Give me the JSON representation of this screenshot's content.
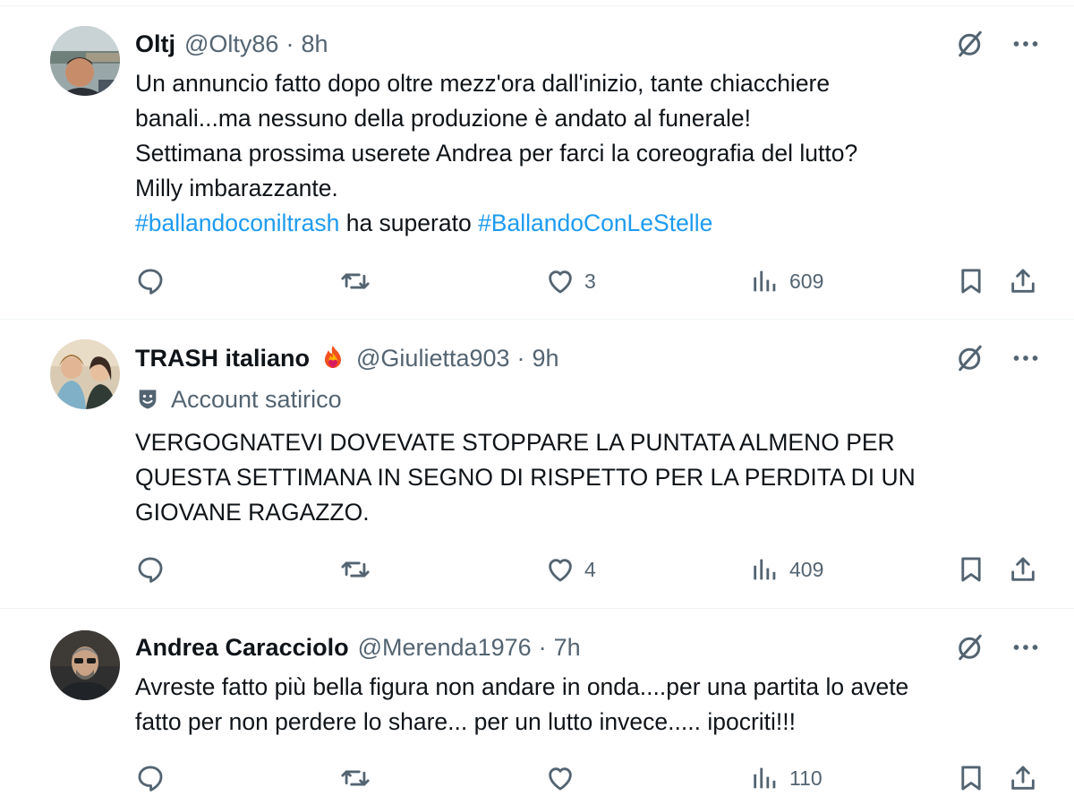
{
  "tweets": [
    {
      "name": "Oltj",
      "handle": "@Olty86",
      "separator": "·",
      "time": "8h",
      "has_badge": false,
      "satire_label": "",
      "lines": [
        "Un annuncio fatto dopo oltre mezz'ora dall'inizio, tante chiacchiere",
        "banali...ma nessuno della produzione è andato al funerale!",
        "Settimana prossima userete Andrea per farci la coreografia del lutto?",
        "Milly imbarazzante."
      ],
      "hashtags": {
        "first": "#ballandoconiltrash",
        "middle": " ha superato ",
        "second": "#BallandoConLeStelle"
      },
      "stats": {
        "replies": "",
        "reposts": "",
        "likes": "3",
        "views": "609"
      }
    },
    {
      "name": "TRASH italiano",
      "handle": "@Giulietta903",
      "separator": "·",
      "time": "9h",
      "has_badge": true,
      "satire_label": "Account satirico",
      "lines": [
        "VERGOGNATEVI DOVEVATE STOPPARE LA PUNTATA ALMENO PER",
        "QUESTA SETTIMANA IN SEGNO DI RISPETTO PER LA PERDITA DI UN",
        "GIOVANE RAGAZZO."
      ],
      "stats": {
        "replies": "",
        "reposts": "",
        "likes": "4",
        "views": "409"
      }
    },
    {
      "name": "Andrea Caracciolo",
      "handle": "@Merenda1976",
      "separator": "·",
      "time": "7h",
      "has_badge": false,
      "satire_label": "",
      "lines": [
        "Avreste fatto più bella figura non andare in onda....per una partita lo avete",
        "fatto per non perdere lo share... per un lutto invece..... ipocriti!!!"
      ],
      "stats": {
        "replies": "",
        "reposts": "",
        "likes": "",
        "views": "110"
      }
    }
  ],
  "icons": {
    "grok": "grok-slash-circle-icon",
    "more": "more-dots-icon",
    "reply": "reply-bubble-icon",
    "repost": "repost-arrows-icon",
    "like": "heart-icon",
    "views": "views-bar-chart-icon",
    "bookmark": "bookmark-icon",
    "share": "share-upload-icon",
    "badge": "fire-heart-badge-icon",
    "satire": "theater-mask-shield-icon"
  },
  "colors": {
    "text": "#0f1419",
    "secondary": "#536471",
    "link": "#1d9bf0",
    "divider": "#eff3f4"
  }
}
